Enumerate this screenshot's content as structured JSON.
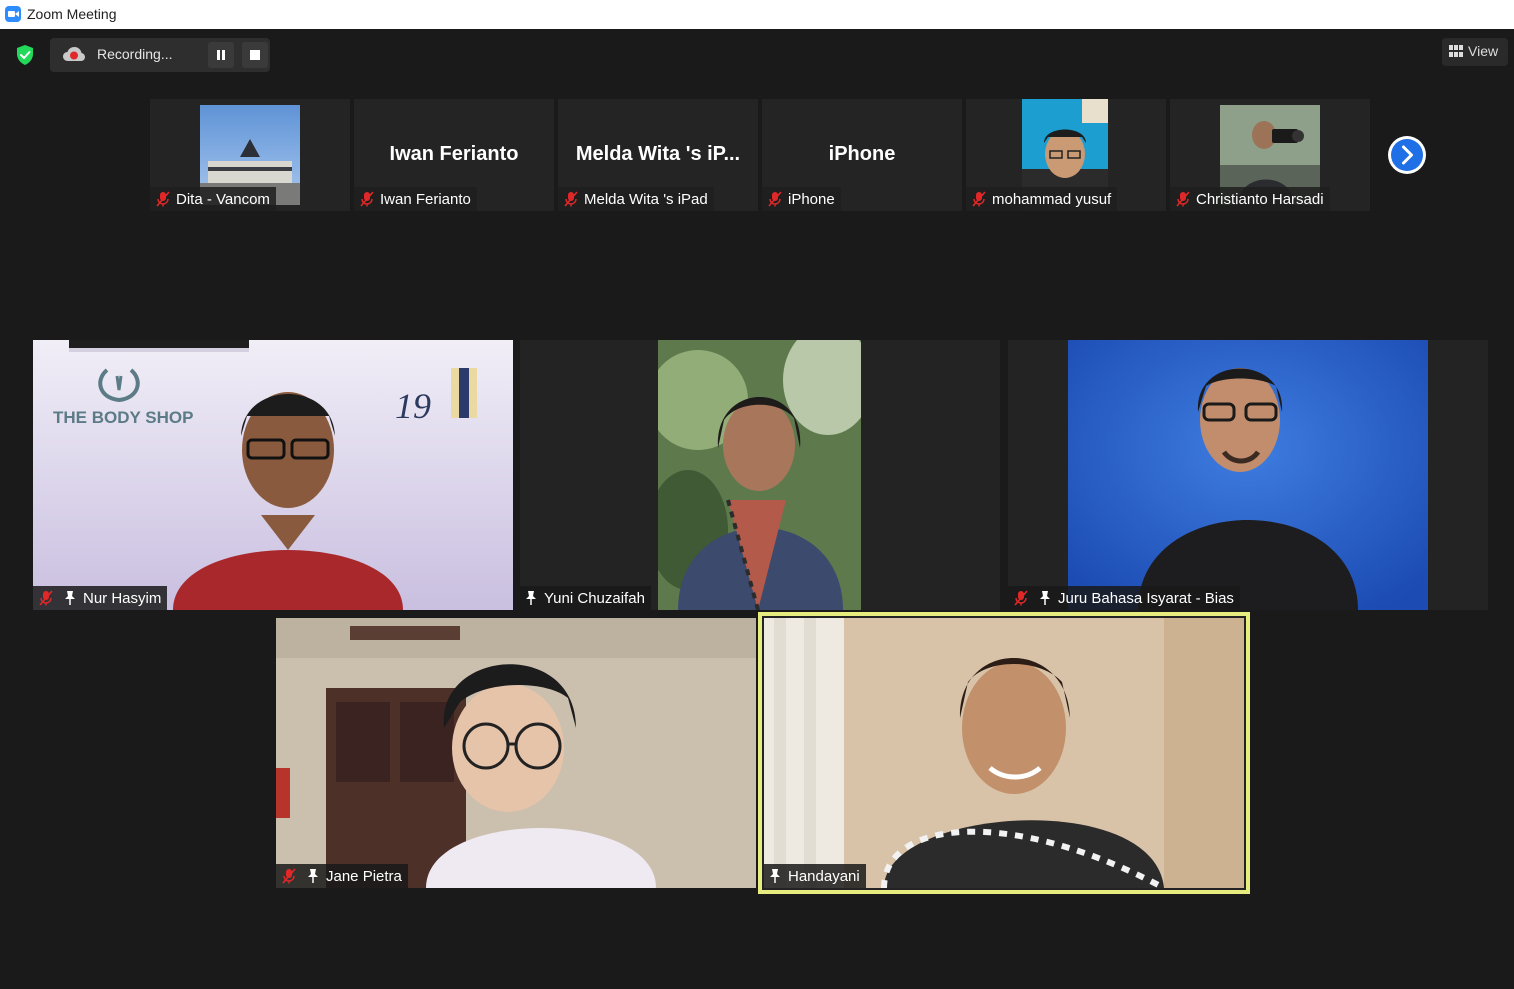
{
  "window": {
    "title": "Zoom Meeting"
  },
  "recording": {
    "label": "Recording..."
  },
  "view": {
    "label": "View"
  },
  "strip": [
    {
      "name": "Dita - Vancom",
      "muted": true,
      "has_video": true
    },
    {
      "name": "Iwan  Ferianto",
      "display_name": "Iwan  Ferianto",
      "muted": true,
      "has_video": false
    },
    {
      "name": "Melda Wita 's iPad",
      "display_name": "Melda Wita 's iP...",
      "muted": true,
      "has_video": false
    },
    {
      "name": "iPhone",
      "display_name": "iPhone",
      "muted": true,
      "has_video": false
    },
    {
      "name": "mohammad yusuf",
      "muted": true,
      "has_video": true
    },
    {
      "name": "Christianto Harsadi",
      "muted": true,
      "has_video": true
    }
  ],
  "tiles": [
    {
      "name": "Nur Hasyim",
      "muted": true,
      "pinned": true,
      "watermark": "THE BODY SHOP"
    },
    {
      "name": "Yuni Chuzaifah",
      "muted": false,
      "pinned": true
    },
    {
      "name": "Juru Bahasa Isyarat - Bias",
      "muted": true,
      "pinned": true
    },
    {
      "name": "Jane Pietra",
      "muted": true,
      "pinned": true
    },
    {
      "name": "Handayani",
      "muted": false,
      "pinned": true,
      "active_speaker": true
    }
  ],
  "colors": {
    "background": "#1a1a1a",
    "accent": "#2d8cff",
    "muted_red": "#e02828",
    "active_speaker": "#e6ec7e"
  }
}
